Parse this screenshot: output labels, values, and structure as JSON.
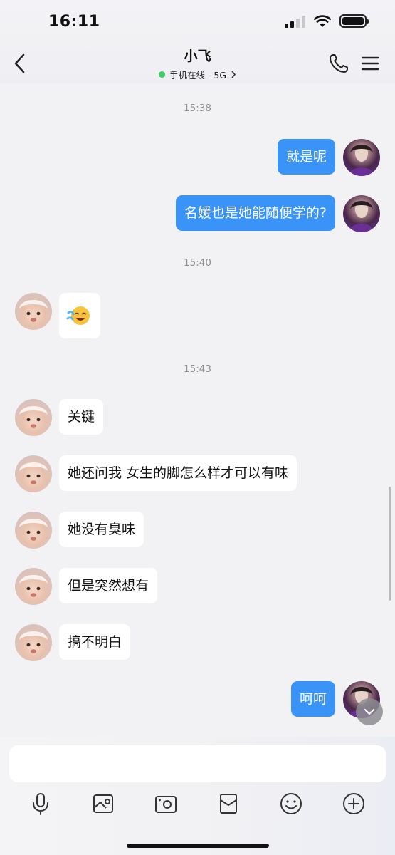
{
  "status_bar": {
    "time": "16:11"
  },
  "header": {
    "title": "小飞",
    "subtitle": "手机在线 - 5G",
    "online_color": "#3ecf6a"
  },
  "colors": {
    "outgoing_bubble": "#3a93f6",
    "incoming_bubble": "#ffffff",
    "background": "#f2f2f4"
  },
  "messages": [
    {
      "type": "time",
      "text": "15:38"
    },
    {
      "type": "out",
      "text": "就是呢"
    },
    {
      "type": "out",
      "text": "名媛也是她能随便学的?"
    },
    {
      "type": "time",
      "text": "15:40"
    },
    {
      "type": "in",
      "kind": "emoji",
      "icon": "laughing-crying-emoji-icon"
    },
    {
      "type": "time",
      "text": "15:43"
    },
    {
      "type": "in",
      "text": "关键"
    },
    {
      "type": "in",
      "text": "她还问我 女生的脚怎么样才可以有味"
    },
    {
      "type": "in",
      "text": "她没有臭味"
    },
    {
      "type": "in",
      "text": "但是突然想有"
    },
    {
      "type": "in",
      "text": "搞不明白"
    },
    {
      "type": "out",
      "text": "呵呵"
    }
  ],
  "composer": {
    "placeholder": ""
  },
  "toolbar_icons": [
    "microphone-icon",
    "image-icon",
    "camera-icon",
    "red-packet-icon",
    "emoji-icon",
    "plus-icon"
  ]
}
